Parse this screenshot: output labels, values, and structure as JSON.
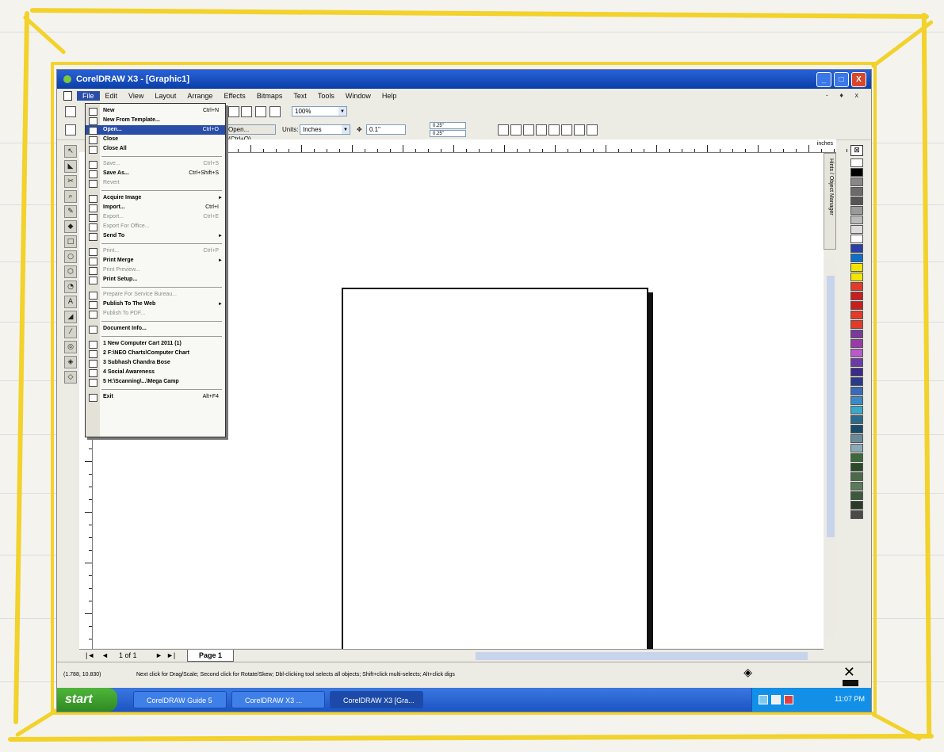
{
  "app": {
    "title": "CorelDRAW X3 - [Graphic1]",
    "window_buttons": [
      "_",
      "□",
      "X"
    ],
    "mdi_controls": "- ♦ x"
  },
  "menubar": {
    "items": [
      "File",
      "Edit",
      "View",
      "Layout",
      "Arrange",
      "Effects",
      "Bitmaps",
      "Text",
      "Tools",
      "Window",
      "Help"
    ],
    "active": "File"
  },
  "toolbar": {
    "zoom": "100%",
    "open_hint": "Open... (Ctrl+O)",
    "units_label": "Units:",
    "units_value": "Inches",
    "nudge": "0.1\"",
    "duplicate_x": "0.25\"",
    "duplicate_y": "0.25\""
  },
  "ruler": {
    "units": "inches"
  },
  "file_menu": {
    "items": [
      {
        "label": "New",
        "shortcut": "Ctrl+N",
        "state": "normal",
        "submenu": false
      },
      {
        "label": "New From Template...",
        "shortcut": "",
        "state": "normal",
        "submenu": false
      },
      {
        "label": "Open...",
        "shortcut": "Ctrl+O",
        "state": "highlighted",
        "submenu": false
      },
      {
        "label": "Close",
        "shortcut": "",
        "state": "normal",
        "submenu": false
      },
      {
        "label": "Close All",
        "shortcut": "",
        "state": "normal",
        "submenu": false
      },
      {
        "sep": true
      },
      {
        "label": "Save...",
        "shortcut": "Ctrl+S",
        "state": "disabled",
        "submenu": false
      },
      {
        "label": "Save As...",
        "shortcut": "Ctrl+Shift+S",
        "state": "normal",
        "submenu": false
      },
      {
        "label": "Revert",
        "shortcut": "",
        "state": "disabled",
        "submenu": false
      },
      {
        "sep": true
      },
      {
        "label": "Acquire Image",
        "shortcut": "",
        "state": "normal",
        "submenu": true
      },
      {
        "label": "Import...",
        "shortcut": "Ctrl+I",
        "state": "normal",
        "submenu": false
      },
      {
        "label": "Export...",
        "shortcut": "Ctrl+E",
        "state": "disabled",
        "submenu": false
      },
      {
        "label": "Export For Office...",
        "shortcut": "",
        "state": "disabled",
        "submenu": false
      },
      {
        "label": "Send To",
        "shortcut": "",
        "state": "normal",
        "submenu": true
      },
      {
        "sep": true
      },
      {
        "label": "Print...",
        "shortcut": "Ctrl+P",
        "state": "disabled",
        "submenu": false
      },
      {
        "label": "Print Merge",
        "shortcut": "",
        "state": "normal",
        "submenu": true
      },
      {
        "label": "Print Preview...",
        "shortcut": "",
        "state": "disabled",
        "submenu": false
      },
      {
        "label": "Print Setup...",
        "shortcut": "",
        "state": "normal",
        "submenu": false
      },
      {
        "sep": true
      },
      {
        "label": "Prepare For Service Bureau...",
        "shortcut": "",
        "state": "disabled",
        "submenu": false
      },
      {
        "label": "Publish To The Web",
        "shortcut": "",
        "state": "normal",
        "submenu": true
      },
      {
        "label": "Publish To PDF...",
        "shortcut": "",
        "state": "disabled",
        "submenu": false
      },
      {
        "sep": true
      },
      {
        "label": "Document Info...",
        "shortcut": "",
        "state": "normal",
        "submenu": false
      },
      {
        "sep": true
      },
      {
        "label": "1 New Computer Cart 2011 (1)",
        "shortcut": "",
        "state": "normal",
        "submenu": false
      },
      {
        "label": "2 F:\\NEO Charts\\Computer Chart",
        "shortcut": "",
        "state": "normal",
        "submenu": false
      },
      {
        "label": "3 Subhash Chandra Bose",
        "shortcut": "",
        "state": "normal",
        "submenu": false
      },
      {
        "label": "4 Social Awareness",
        "shortcut": "",
        "state": "normal",
        "submenu": false
      },
      {
        "label": "5 H:\\Scanning\\...\\Mega Camp",
        "shortcut": "",
        "state": "normal",
        "submenu": false
      },
      {
        "sep": true
      },
      {
        "label": "Exit",
        "shortcut": "Alt+F4",
        "state": "normal",
        "submenu": false
      }
    ]
  },
  "page_nav": {
    "first": "|◄",
    "prev": "◄",
    "count": "1 of 1",
    "next": "►",
    "last": "►|",
    "tab": "Page 1"
  },
  "docker_tab": "Hints / Object Manager",
  "palette_colors": [
    "#ffffff",
    "#000000",
    "#888888",
    "#6b6b6b",
    "#555555",
    "#9a9a9a",
    "#bbbbbb",
    "#dddddd",
    "#ffffff",
    "#2b3fa8",
    "#0f6fc8",
    "#f2e600",
    "#f2e600",
    "#e33a2a",
    "#c81e1e",
    "#c81e1e",
    "#e33a2a",
    "#e33a2a",
    "#7a3a9a",
    "#9a3aa8",
    "#b85ac8",
    "#6a3aa8",
    "#3a2a8a",
    "#2a3a8a",
    "#3a6ab8",
    "#3a8ac8",
    "#3aa8c8",
    "#2a6a8a",
    "#1a4a6a",
    "#6a8a9a",
    "#8aaab8",
    "#3a6a3a",
    "#2a4a2a",
    "#4a6a4a",
    "#5a7a5a",
    "#3a5a3a",
    "#2a3a2a",
    "#4a4a4a"
  ],
  "status": {
    "coords": "(1.788, 10.830)",
    "message": "Next click for Drag/Scale; Second click for Rotate/Skew; Dbl-clicking tool selects all objects; Shift+click multi-selects; Alt+click digs"
  },
  "taskbar": {
    "start": "start",
    "items": [
      "CorelDRAW Guide 5",
      "CorelDRAW X3 ...",
      "CorelDRAW X3 [Gra..."
    ],
    "clock": "11:07 PM"
  }
}
